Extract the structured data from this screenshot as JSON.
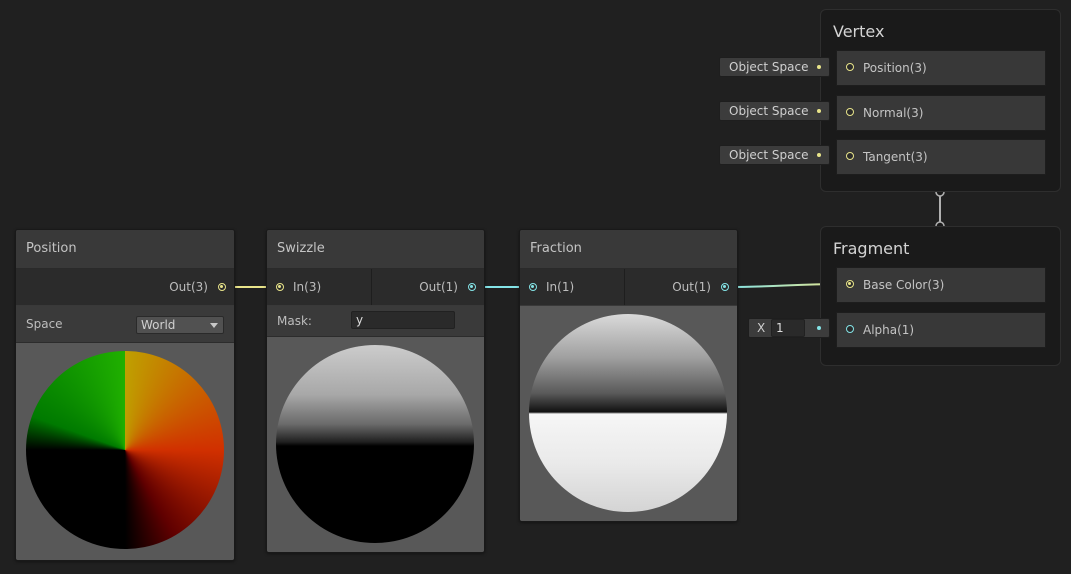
{
  "nodes": {
    "position": {
      "title": "Position",
      "output": "Out(3)",
      "space_label": "Space",
      "space_value": "World"
    },
    "swizzle": {
      "title": "Swizzle",
      "input": "In(3)",
      "output": "Out(1)",
      "mask_label": "Mask:",
      "mask_value": "y"
    },
    "fraction": {
      "title": "Fraction",
      "input": "In(1)",
      "output": "Out(1)"
    }
  },
  "vertex": {
    "title": "Vertex",
    "blocks": [
      {
        "label": "Position(3)",
        "inline": "Object Space"
      },
      {
        "label": "Normal(3)",
        "inline": "Object Space"
      },
      {
        "label": "Tangent(3)",
        "inline": "Object Space"
      }
    ]
  },
  "fragment": {
    "title": "Fragment",
    "blocks": [
      {
        "label": "Base Color(3)"
      },
      {
        "label": "Alpha(1)",
        "inline_label": "X",
        "inline_value": "1"
      }
    ]
  },
  "colors": {
    "background": "#202020",
    "vector3_port": "#e8e48a",
    "float_port": "#84e4e7"
  }
}
